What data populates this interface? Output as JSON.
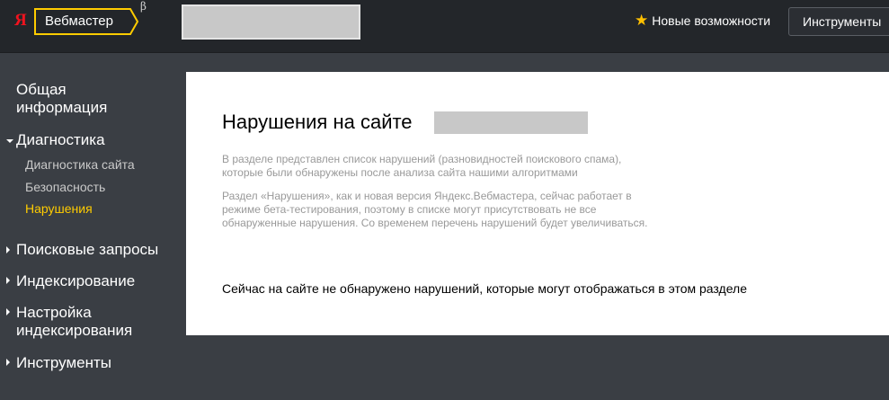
{
  "header": {
    "logo": "Я",
    "service_name": "Вебмастер",
    "beta_mark": "β",
    "whats_new": "Новые возможности",
    "tools_button": "Инструменты",
    "accent_color": "#ffcc00",
    "logo_color": "#f0131e"
  },
  "sidebar": {
    "items": [
      {
        "label": "Общая информация",
        "expanded": false
      },
      {
        "label": "Диагностика",
        "expanded": true,
        "children": [
          {
            "label": "Диагностика сайта",
            "active": false
          },
          {
            "label": "Безопасность",
            "active": false
          },
          {
            "label": "Нарушения",
            "active": true
          }
        ]
      },
      {
        "label": "Поисковые запросы",
        "expanded": false
      },
      {
        "label": "Индексирование",
        "expanded": false
      },
      {
        "label": "Настройка индексирования",
        "expanded": false
      },
      {
        "label": "Инструменты",
        "expanded": false
      }
    ],
    "active_color": "#ffcc00"
  },
  "main": {
    "title": "Нарушения на сайте",
    "description_1": "В разделе представлен список нарушений (разновидностей поискового спама), которые были обнаружены после анализа сайта нашими алгоритмами",
    "description_2": "Раздел «Нарушения», как и новая версия Яндекс.Вебмастера, сейчас работает в режиме бета-тестирования, поэтому в списке могут присутствовать не все обнаруженные нарушения. Со временем перечень нарушений будет увеличиваться.",
    "status_text": "Сейчас на сайте не обнаружено нарушений, которые могут отображаться в этом разделе"
  }
}
